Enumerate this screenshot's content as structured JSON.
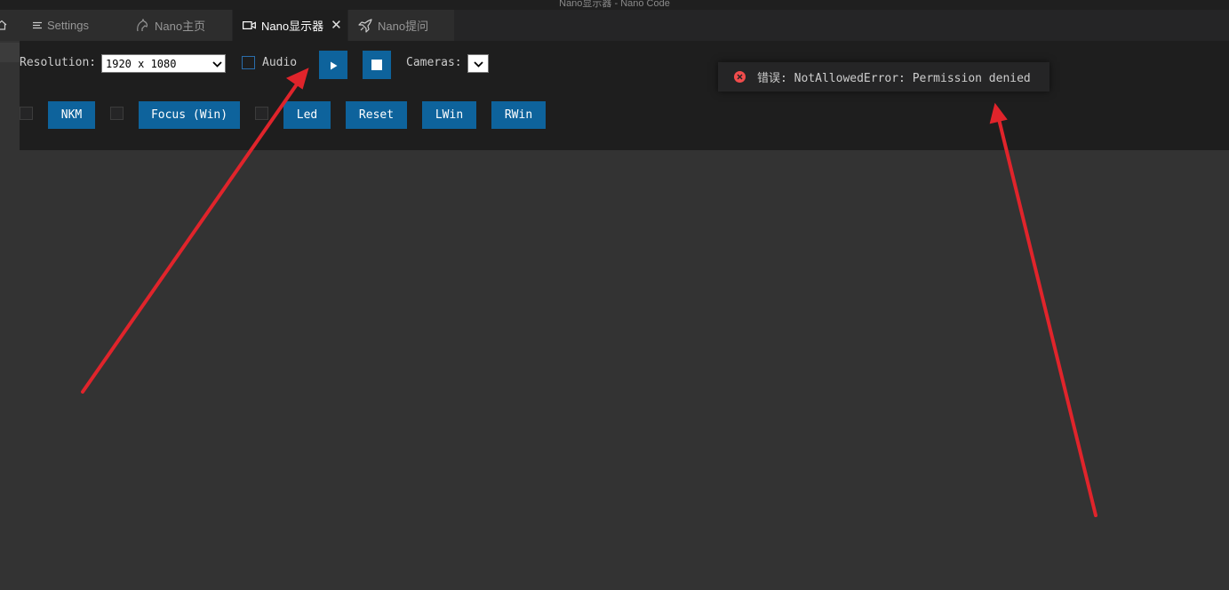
{
  "window": {
    "title": "Nano显示器 - Nano Code"
  },
  "tabs": [
    {
      "label": "Settings",
      "icon": "settings-lines-icon",
      "active": false
    },
    {
      "label": "Nano主页",
      "icon": "horse-icon",
      "active": false
    },
    {
      "label": "Nano显示器",
      "icon": "camera-icon",
      "active": true,
      "close": "✕"
    },
    {
      "label": "Nano提问",
      "icon": "rocket-icon",
      "active": false
    }
  ],
  "toolbar": {
    "resolution_label": "Resolution:",
    "resolution_value": "1920 x 1080",
    "audio_label": "Audio",
    "play_icon": "play-icon",
    "stop_icon": "stop-icon",
    "cameras_label": "Cameras:",
    "cameras_value": ""
  },
  "controls": {
    "nkm": "NKM",
    "focus": "Focus (Win)",
    "led": "Led",
    "reset": "Reset",
    "lwin": "LWin",
    "rwin": "RWin"
  },
  "notification": {
    "icon": "error-icon",
    "message": "错误: NotAllowedError: Permission denied"
  },
  "colors": {
    "accent_button": "#0e639c",
    "error": "#f14c4c",
    "annotation_arrow": "#e0242b"
  }
}
